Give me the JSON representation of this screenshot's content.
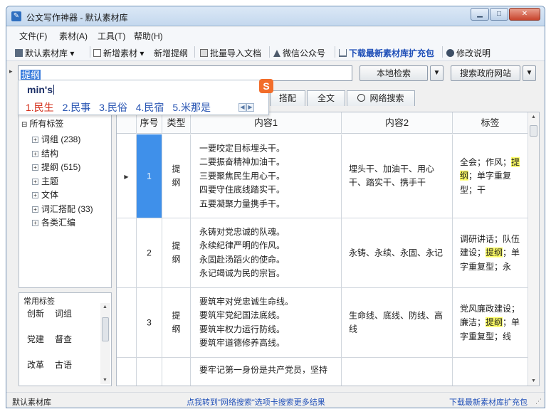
{
  "window": {
    "title": "公文写作神器 - 默认素材库",
    "controls": {
      "minimize": "▁",
      "maximize": "□",
      "close": "✕"
    }
  },
  "menu": [
    "文件(F)",
    "素材(A)",
    "工具(T)",
    "帮助(H)"
  ],
  "toolbar": {
    "library_label": "默认素材库",
    "library_dropdown": "▾",
    "new_material_label": "新增素材",
    "new_material_dropdown": "▾",
    "new_outline_label": "新增提纲",
    "batch_import_label": "批量导入文档",
    "wechat_label": "微信公众号",
    "download_label": "下载最新素材库扩充包",
    "help_label": "修改说明"
  },
  "search": {
    "query": "提纲",
    "local_search_label": "本地检索",
    "gov_search_label": "搜索政府网站",
    "dropdown_glyph": "▼"
  },
  "ime": {
    "typed": "min's",
    "candidates": [
      "1.民生",
      "2.民事",
      "3.民俗",
      "4.民宿",
      "5.米那是"
    ],
    "logo": "S",
    "prev": "◀",
    "next": "▶"
  },
  "tabs": [
    "搭配",
    "全文",
    "网络搜索"
  ],
  "tree": {
    "root": "所有标签",
    "root_expander": "⊟",
    "items": [
      {
        "label": "词组 (238)"
      },
      {
        "label": "结构"
      },
      {
        "label": "提纲 (515)"
      },
      {
        "label": "主题"
      },
      {
        "label": "文体"
      },
      {
        "label": "词汇搭配 (33)"
      },
      {
        "label": "各类汇编"
      }
    ],
    "child_expander": "+"
  },
  "common_tags": {
    "title": "常用标签",
    "tags": [
      "创新",
      "词组",
      "党建",
      "督查",
      "改革",
      "古语"
    ]
  },
  "grid": {
    "columns": [
      "序号",
      "类型",
      "内容1",
      "内容2",
      "标签"
    ],
    "row_pointer": "▶",
    "rows": [
      {
        "no": "1",
        "type": "提\n纲",
        "content1": "一要咬定目标埋头干。\n二要振奋精神加油干。\n三要聚焦民生用心干。\n四要守住底线踏实干。\n五要凝聚力量携手干。",
        "content2": "埋头干、加油干、用心干、踏实干、携手干",
        "tag_before": "全会；作风；",
        "tag_hl": "提纲",
        "tag_after": "；单字重复型；干"
      },
      {
        "no": "2",
        "type": "提\n纲",
        "content1": "永铸对党忠诚的队魂。\n永续纪律严明的作风。\n永固赴汤蹈火的使命。\n永记竭诚为民的宗旨。",
        "content2": "永铸、永续、永固、永记",
        "tag_before": "调研讲话；队伍建设；",
        "tag_hl": "提纲",
        "tag_after": "；单字重复型；永"
      },
      {
        "no": "3",
        "type": "提\n纲",
        "content1": "要筑牢对党忠诚生命线。\n要筑牢党纪国法底线。\n要筑牢权力运行防线。\n要筑牢道德修养高线。",
        "content2": "生命线、底线、防线、高线",
        "tag_before": "党风廉政建设；廉洁；",
        "tag_hl": "提纲",
        "tag_after": "；单字重复型；线"
      },
      {
        "no": "",
        "type": "",
        "content1": "要牢记第一身份是共产党员，坚持",
        "content2": "",
        "tag_before": "",
        "tag_hl": "",
        "tag_after": ""
      }
    ]
  },
  "status": {
    "left": "默认素材库",
    "middle": "点我转到\"网络搜索\"选项卡搜索更多结果",
    "right": "下载最新素材库扩充包"
  }
}
